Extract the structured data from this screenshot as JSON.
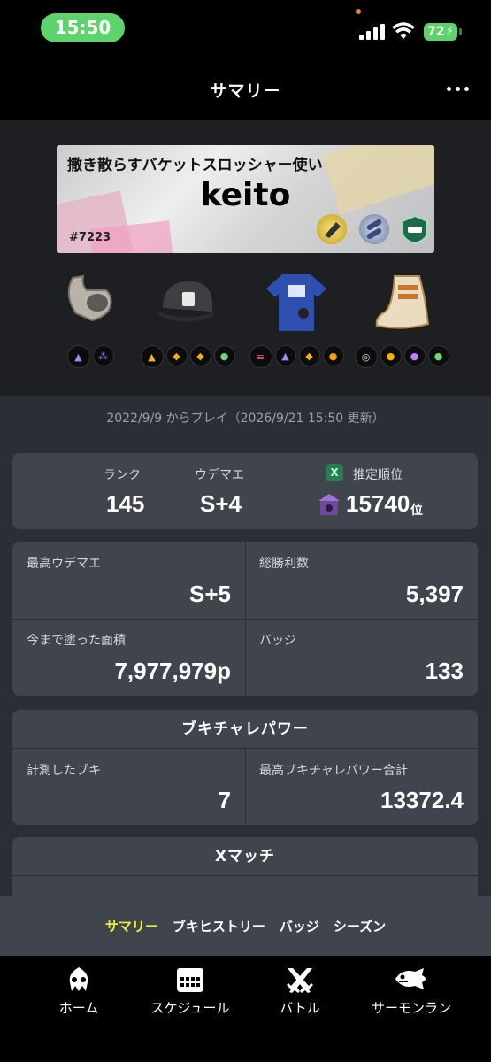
{
  "status_bar": {
    "time": "15:50",
    "battery": "72"
  },
  "header": {
    "title": "サマリー"
  },
  "banner": {
    "title": "撒き散らすバケットスロッシャー使い",
    "player_name": "keito",
    "tag": "#7223",
    "badges": [
      "slosher-badge-icon",
      "gear-badge-icon",
      "rank-badge-icon"
    ]
  },
  "gear": [
    {
      "name": "headgear",
      "icon": "goggles-icon",
      "abilities": [
        "main-ability-icon",
        "sub-ability-icon"
      ]
    },
    {
      "name": "cap",
      "icon": "cap-icon",
      "abilities": [
        "main-ability-icon",
        "sub-ability-icon",
        "sub-ability-icon",
        "sub-ability-icon"
      ]
    },
    {
      "name": "shirt",
      "icon": "shirt-icon",
      "abilities": [
        "main-ability-icon",
        "sub-ability-icon",
        "sub-ability-icon",
        "sub-ability-icon"
      ]
    },
    {
      "name": "shoes",
      "icon": "shoes-icon",
      "abilities": [
        "main-ability-icon",
        "sub-ability-icon",
        "sub-ability-icon",
        "sub-ability-icon"
      ]
    }
  ],
  "play_since": "2022/9/9 からプレイ（2026/9/21 15:50 更新）",
  "rank_card": {
    "rank_label": "ランク",
    "rank_value": "145",
    "udemae_label": "ウデマエ",
    "udemae_value": "S+4",
    "estimate_label": "推定順位",
    "estimate_value": "15740",
    "estimate_unit": "位"
  },
  "stats_card": {
    "max_udemae_label": "最高ウデマエ",
    "max_udemae_value": "S+5",
    "total_wins_label": "総勝利数",
    "total_wins_value": "5,397",
    "painted_label": "今まで塗った面積",
    "painted_value": "7,977,979p",
    "badges_label": "バッジ",
    "badges_value": "133"
  },
  "power_card": {
    "title": "ブキチャレパワー",
    "measured_label": "計測したブキ",
    "measured_value": "7",
    "max_power_label": "最高ブキチャレパワー合計",
    "max_power_value": "13372.4"
  },
  "xmatch_card": {
    "title": "Xマッチ"
  },
  "sub_tabs": [
    {
      "label": "サマリー",
      "active": true
    },
    {
      "label": "ブキヒストリー",
      "active": false
    },
    {
      "label": "バッジ",
      "active": false
    },
    {
      "label": "シーズン",
      "active": false
    }
  ],
  "bottom_nav": [
    {
      "label": "ホーム",
      "icon": "squid-icon"
    },
    {
      "label": "スケジュール",
      "icon": "calendar-icon"
    },
    {
      "label": "バトル",
      "icon": "battle-icon"
    },
    {
      "label": "サーモンラン",
      "icon": "salmon-icon"
    }
  ],
  "colors": {
    "accent": "#e8ef3a",
    "time_pill": "#5ed26c",
    "card": "#40444d",
    "background": "#2b2e35"
  }
}
